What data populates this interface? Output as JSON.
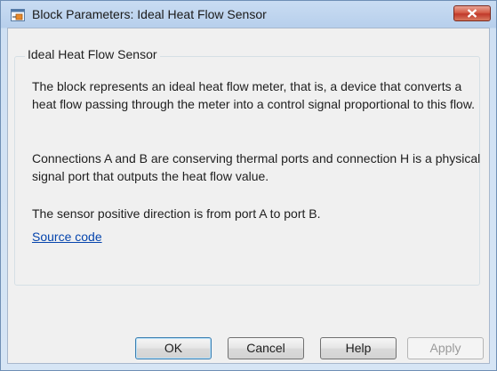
{
  "window": {
    "title": "Block Parameters: Ideal Heat Flow Sensor"
  },
  "group": {
    "title": "Ideal Heat Flow Sensor",
    "paragraphs": [
      "The block represents an ideal heat flow meter, that is, a device that converts a heat flow passing through the meter into a control signal proportional to this flow.",
      "Connections A and B are conserving thermal ports and connection H is a physical signal port that outputs the heat flow value.",
      "The sensor positive direction is from port A to port B."
    ],
    "link_label": "Source code"
  },
  "buttons": {
    "ok": "OK",
    "cancel": "Cancel",
    "help": "Help",
    "apply": "Apply"
  },
  "colors": {
    "title_gradient": "#c9dcf2",
    "close_button": "#c0392b",
    "link": "#0645ad",
    "dialog_background": "#f0f0f0"
  },
  "icons": {
    "title": "simulink-block-icon",
    "close": "close-icon"
  }
}
